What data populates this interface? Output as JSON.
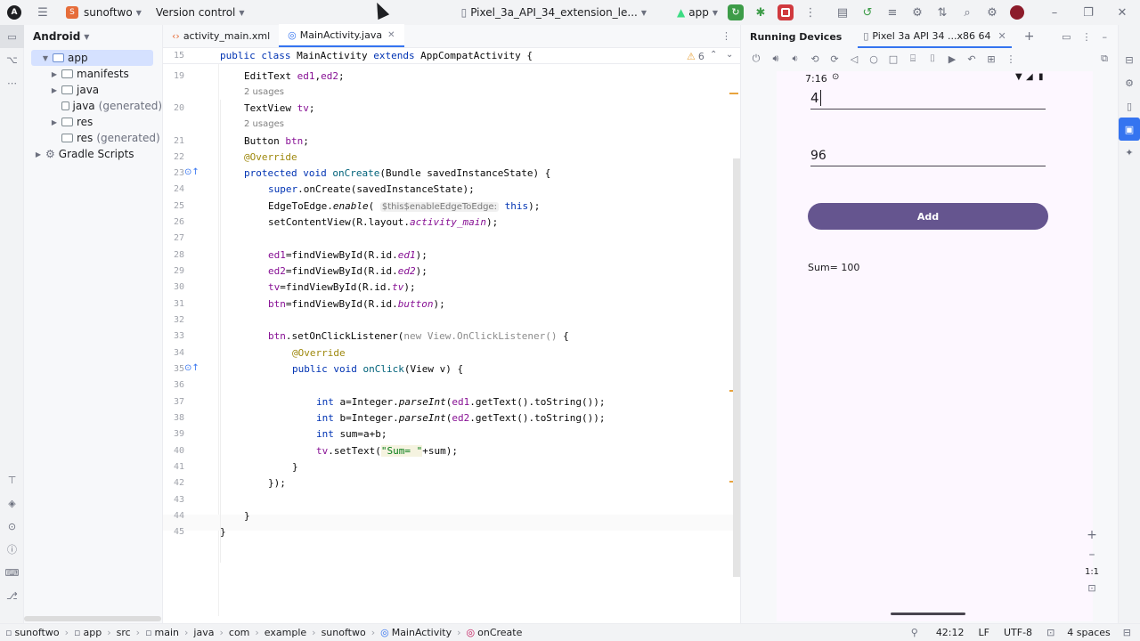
{
  "titlebar": {
    "project_badge": "S",
    "project_name": "sunoftwo",
    "vcs": "Version control",
    "device": "Pixel_3a_API_34_extension_le...",
    "run_config": "app"
  },
  "project_panel": {
    "view_mode": "Android",
    "tree": [
      {
        "label": "app",
        "depth": 0
      },
      {
        "label": "manifests",
        "depth": 1
      },
      {
        "label": "java",
        "depth": 1
      },
      {
        "label": "java",
        "suffix": "(generated)",
        "depth": 1
      },
      {
        "label": "res",
        "depth": 1
      },
      {
        "label": "res",
        "suffix": "(generated)",
        "depth": 1
      },
      {
        "label": "Gradle Scripts",
        "depth": 0
      }
    ]
  },
  "editor": {
    "tabs": [
      "activity_main.xml",
      "MainActivity.java"
    ],
    "warnings": "6",
    "sticky_line": "15",
    "lines": {
      "l19": "19",
      "l20": "20",
      "l21": "21",
      "l22": "22",
      "l23": "23",
      "l24": "24",
      "l25": "25",
      "l26": "26",
      "l27": "27",
      "l28": "28",
      "l29": "29",
      "l30": "30",
      "l31": "31",
      "l32": "32",
      "l33": "33",
      "l34": "34",
      "l35": "35",
      "l36": "36",
      "l37": "37",
      "l38": "38",
      "l39": "39",
      "l40": "40",
      "l41": "41",
      "l42": "42",
      "l43": "43",
      "l44": "44",
      "l45": "45"
    },
    "usages": "2 usages",
    "hint_param": "$this$enableEdgeToEdge:"
  },
  "device_panel": {
    "title": "Running Devices",
    "device_tab": "Pixel 3a API 34 ...x86 64",
    "time": "7:16",
    "field1": "4",
    "field2": "96",
    "button": "Add",
    "result": "Sum= 100",
    "zoom": "1:1"
  },
  "statusbar": {
    "breadcrumb": [
      "sunoftwo",
      "app",
      "src",
      "main",
      "java",
      "com",
      "example",
      "sunoftwo",
      "MainActivity",
      "onCreate"
    ],
    "position": "42:12",
    "line_sep": "LF",
    "encoding": "UTF-8",
    "indent": "4 spaces"
  }
}
